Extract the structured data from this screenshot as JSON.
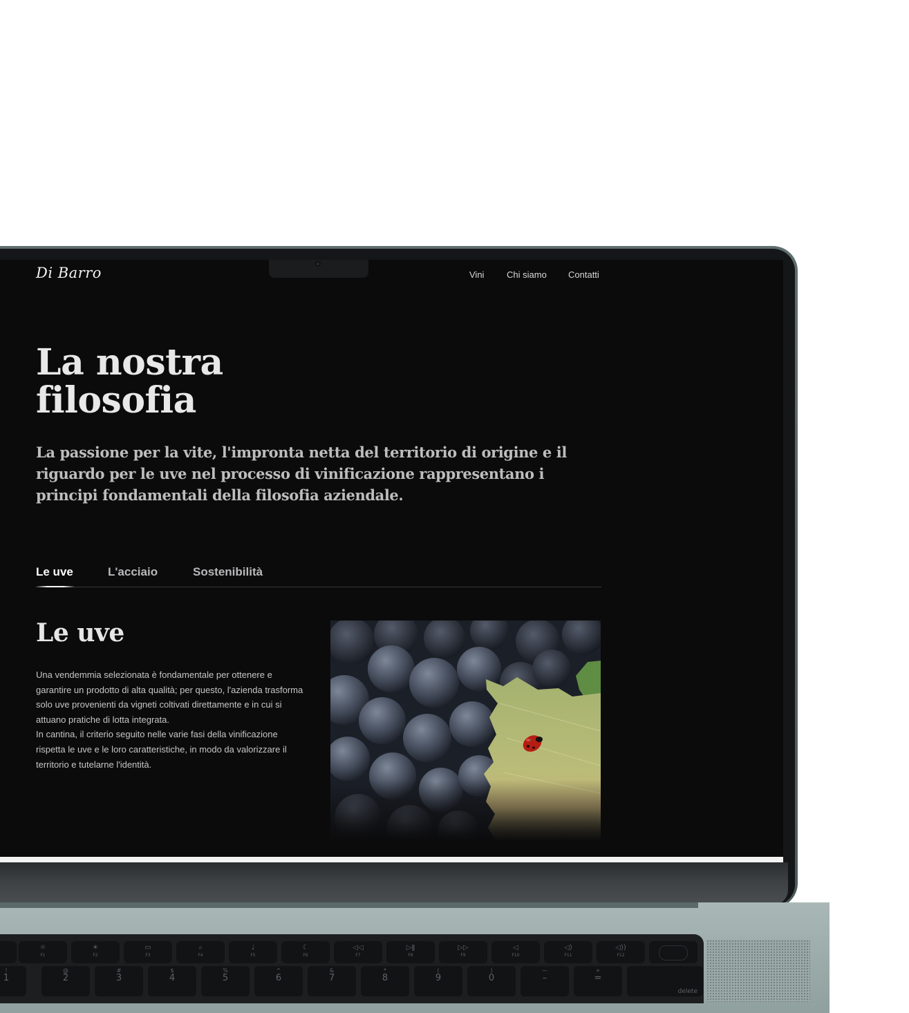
{
  "site": {
    "logo_text": "Di Barro"
  },
  "nav": {
    "items": [
      {
        "label": "Vini"
      },
      {
        "label": "Chi siamo"
      },
      {
        "label": "Contatti"
      }
    ]
  },
  "hero": {
    "title_lines": [
      "La nostra",
      "filosofia"
    ],
    "lead": "La passione per la vite, l'impronta netta del territorio di origine e il riguardo per le uve nel processo di vinificazione rappresentano i principi fondamentali della filosofia aziendale."
  },
  "tabs": [
    {
      "label": "Le uve",
      "active": true
    },
    {
      "label": "L'acciaio",
      "active": false
    },
    {
      "label": "Sostenibilità",
      "active": false
    }
  ],
  "section": {
    "title": "Le uve",
    "paragraph_1": "Una vendemmia selezionata è fondamentale per ottenere e garantire un prodotto di alta qualità; per questo, l'azienda trasforma solo uve provenienti da vigneti coltivati direttamente e in cui si attuano pratiche di lotta integrata.",
    "paragraph_2": "In cantina, il criterio seguito nelle varie fasi della vinificazione rispetta le uve e le loro caratteristiche, in modo da valorizzare il territorio e tutelarne l'identità.",
    "image": {
      "icon": "grapes-ladybug-photo"
    }
  },
  "keyboard": {
    "function_row": [
      {
        "icon": "escape-key",
        "fn": ""
      },
      {
        "icon": "brightness-down-icon",
        "fn": "F1"
      },
      {
        "icon": "brightness-up-icon",
        "fn": "F2"
      },
      {
        "icon": "mission-control-icon",
        "fn": "F3"
      },
      {
        "icon": "search-icon",
        "fn": "F4"
      },
      {
        "icon": "microphone-icon",
        "fn": "F5"
      },
      {
        "icon": "moon-icon",
        "fn": "F6"
      },
      {
        "icon": "rewind-icon",
        "fn": "F7"
      },
      {
        "icon": "play-pause-icon",
        "fn": "F8"
      },
      {
        "icon": "fast-forward-icon",
        "fn": "F9"
      },
      {
        "icon": "mute-icon",
        "fn": "F10"
      },
      {
        "icon": "volume-down-icon",
        "fn": "F11"
      },
      {
        "icon": "volume-up-icon",
        "fn": "F12"
      }
    ],
    "number_row": [
      {
        "top": "!",
        "num": "1"
      },
      {
        "top": "@",
        "num": "2"
      },
      {
        "top": "#",
        "num": "3"
      },
      {
        "top": "$",
        "num": "4"
      },
      {
        "top": "%",
        "num": "5"
      },
      {
        "top": "^",
        "num": "6"
      },
      {
        "top": "&",
        "num": "7"
      },
      {
        "top": "*",
        "num": "8"
      },
      {
        "top": "(",
        "num": "9"
      },
      {
        "top": ")",
        "num": "0"
      },
      {
        "top": "—",
        "num": "–"
      },
      {
        "top": "+",
        "num": "="
      }
    ],
    "delete_label": "delete"
  }
}
